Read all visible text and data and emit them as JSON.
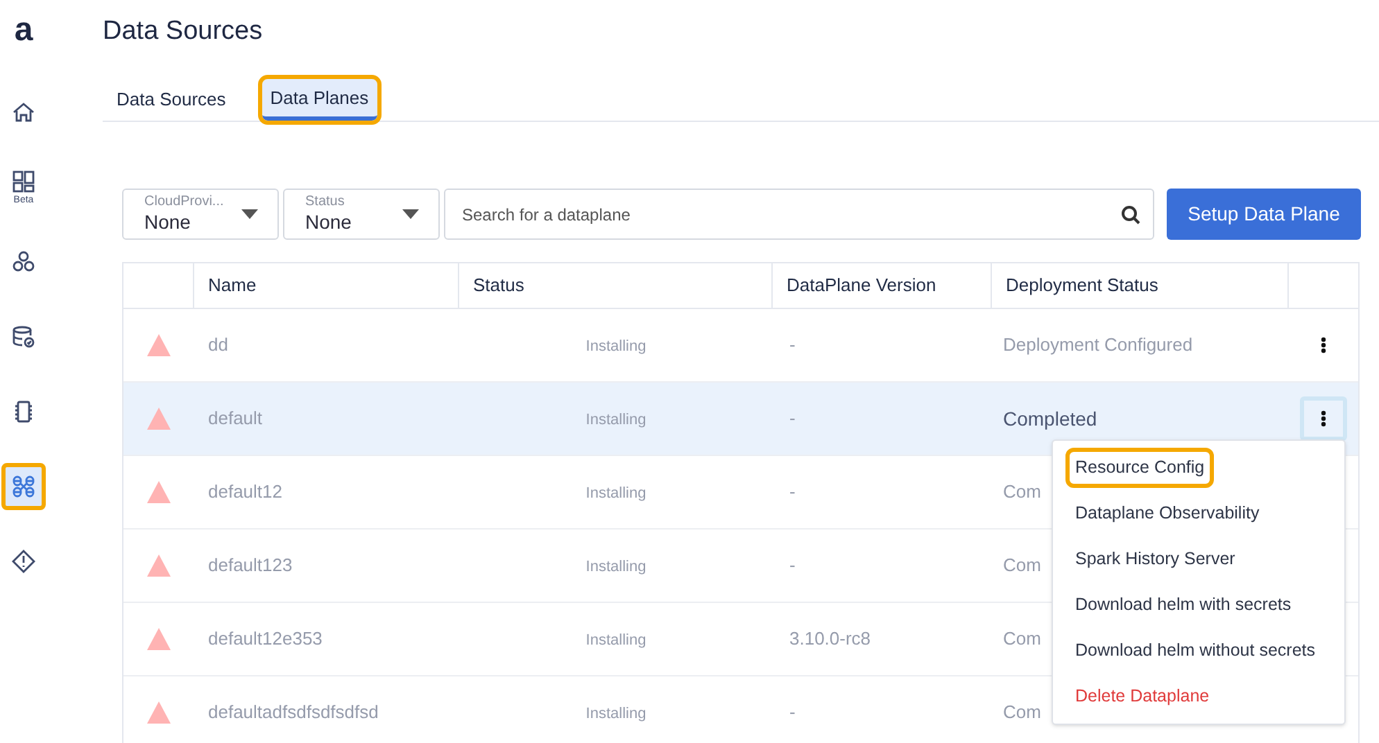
{
  "sidebar": {
    "logo": "a",
    "items": [
      {
        "kind": "home",
        "selected": false,
        "highlighted": false
      },
      {
        "kind": "dashboard",
        "label": "Beta",
        "selected": false,
        "highlighted": false
      },
      {
        "kind": "nodes",
        "selected": false,
        "highlighted": false
      },
      {
        "kind": "database",
        "selected": false,
        "highlighted": false
      },
      {
        "kind": "chip",
        "selected": false,
        "highlighted": false
      },
      {
        "kind": "network",
        "selected": true,
        "highlighted": true
      },
      {
        "kind": "warning",
        "selected": false,
        "highlighted": false
      }
    ]
  },
  "page": {
    "title": "Data Sources"
  },
  "tabs": [
    {
      "label": "Data Sources",
      "selected": false,
      "highlighted": false
    },
    {
      "label": "Data Planes",
      "selected": true,
      "highlighted": true
    }
  ],
  "filters": [
    {
      "label": "CloudProvi...",
      "value": "None"
    },
    {
      "label": "Status",
      "value": "None"
    }
  ],
  "search": {
    "placeholder": "Search for a dataplane"
  },
  "setup_button": "Setup Data Plane",
  "table": {
    "columns": [
      "Name",
      "Status",
      "DataPlane Version",
      "Deployment Status"
    ],
    "rows": [
      {
        "name": "dd",
        "status": "Installing",
        "version": "-",
        "deployment": "Deployment Configured",
        "faded": true,
        "hovered": false,
        "menu_open": false
      },
      {
        "name": "default",
        "status": "Installing",
        "version": "-",
        "deployment": "Completed",
        "faded": true,
        "hovered": true,
        "menu_open": true
      },
      {
        "name": "default12",
        "status": "Installing",
        "version": "-",
        "deployment": "Com",
        "faded": true,
        "hovered": false
      },
      {
        "name": "default123",
        "status": "Installing",
        "version": "-",
        "deployment": "Com",
        "faded": true,
        "hovered": false
      },
      {
        "name": "default12e353",
        "status": "Installing",
        "version": "3.10.0-rc8",
        "deployment": "Com",
        "faded": true,
        "hovered": false
      },
      {
        "name": "defaultadfsdfsdfsdfsd",
        "status": "Installing",
        "version": "-",
        "deployment": "Com",
        "faded": true,
        "hovered": false
      }
    ]
  },
  "row_menu": {
    "items": [
      {
        "label": "Resource Config",
        "kind": "normal",
        "highlighted": true
      },
      {
        "label": "Dataplane Observability",
        "kind": "normal",
        "highlighted": false
      },
      {
        "label": "Spark History Server",
        "kind": "normal",
        "highlighted": false
      },
      {
        "label": "Download helm with secrets",
        "kind": "normal",
        "highlighted": false
      },
      {
        "label": "Download helm without secrets",
        "kind": "normal",
        "highlighted": false
      },
      {
        "label": "Delete Dataplane",
        "kind": "danger",
        "highlighted": false
      }
    ]
  }
}
